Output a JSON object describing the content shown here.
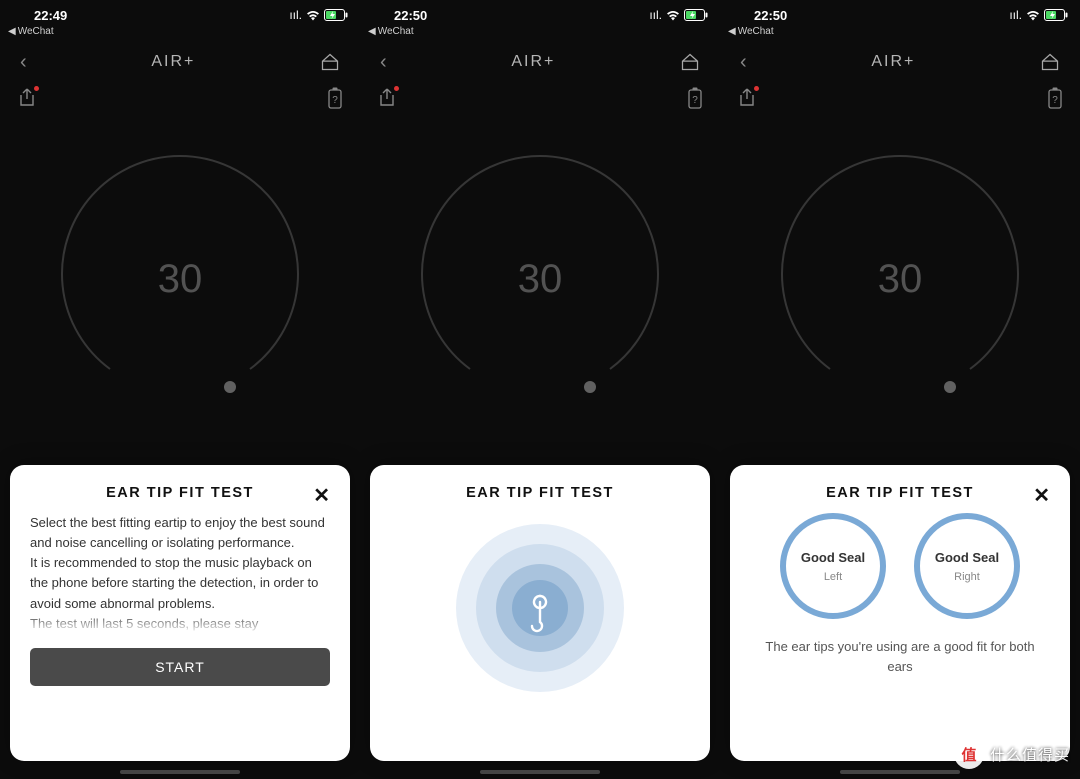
{
  "status_icons": {
    "signal": "ııl.",
    "wifi": "wifi",
    "battery": "charging"
  },
  "screens": [
    {
      "time": "22:49",
      "back_app": "WeChat",
      "title": "AIR+",
      "dial_value": "30",
      "sheet": {
        "title": "EAR TIP FIT TEST",
        "has_close": true,
        "body_p1": "Select the best fitting eartip to enjoy the best sound and noise cancelling or isolating performance.",
        "body_p2": "It is recommended to stop the music playback on the phone before starting the detection, in order to avoid some abnormal problems.",
        "body_p3": "The test will last 5 seconds, please stay",
        "start_label": "START"
      }
    },
    {
      "time": "22:50",
      "back_app": "WeChat",
      "title": "AIR+",
      "dial_value": "30",
      "sheet": {
        "title": "EAR TIP FIT TEST",
        "has_close": false
      }
    },
    {
      "time": "22:50",
      "back_app": "WeChat",
      "title": "AIR+",
      "dial_value": "30",
      "sheet": {
        "title": "EAR TIP FIT TEST",
        "has_close": true,
        "left_status": "Good Seal",
        "left_side": "Left",
        "right_status": "Good Seal",
        "right_side": "Right",
        "result_msg": "The ear tips you're using are a good fit for both ears"
      }
    }
  ],
  "watermark": "什么值得买"
}
